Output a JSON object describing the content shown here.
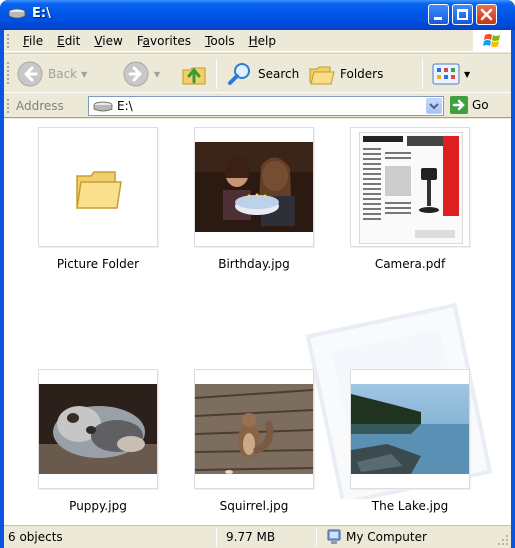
{
  "window": {
    "title": "E:\\",
    "titlebar_color": "#0055e5"
  },
  "menu": {
    "items": [
      {
        "label": "File",
        "accel": "F"
      },
      {
        "label": "Edit",
        "accel": "E"
      },
      {
        "label": "View",
        "accel": "V"
      },
      {
        "label": "Favorites",
        "accel": "a"
      },
      {
        "label": "Tools",
        "accel": "T"
      },
      {
        "label": "Help",
        "accel": "H"
      }
    ]
  },
  "toolbar": {
    "back_label": "Back",
    "search_label": "Search",
    "folders_label": "Folders"
  },
  "address": {
    "label": "Address",
    "value": "E:\\",
    "go_label": "Go"
  },
  "files": [
    {
      "name": "Picture Folder",
      "kind": "folder"
    },
    {
      "name": "Birthday.jpg",
      "kind": "photo"
    },
    {
      "name": "Camera.pdf",
      "kind": "pdf"
    },
    {
      "name": "Puppy.jpg",
      "kind": "photo"
    },
    {
      "name": "Squirrel.jpg",
      "kind": "photo"
    },
    {
      "name": "The Lake.jpg",
      "kind": "photo"
    }
  ],
  "status": {
    "objects": "6 objects",
    "size": "9.77 MB",
    "location": "My Computer"
  }
}
